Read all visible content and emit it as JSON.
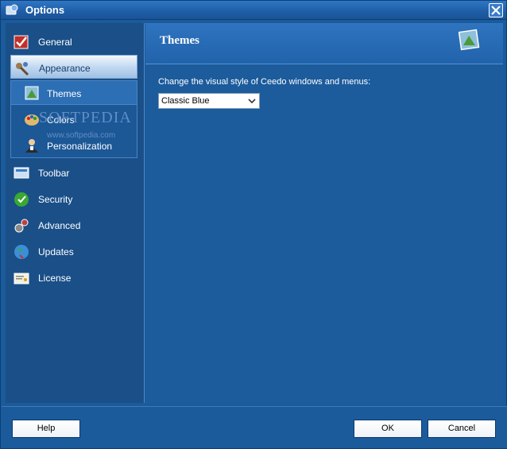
{
  "window": {
    "title": "Options",
    "title_icon": "ceedo-options-icon",
    "close_icon": "close-icon"
  },
  "sidebar": {
    "items": [
      {
        "label": "General",
        "icon": "general-check-icon"
      },
      {
        "label": "Appearance",
        "icon": "appearance-brush-icon",
        "selected": true
      },
      {
        "label": "Toolbar",
        "icon": "toolbar-icon"
      },
      {
        "label": "Security",
        "icon": "security-shield-icon"
      },
      {
        "label": "Advanced",
        "icon": "advanced-gears-icon"
      },
      {
        "label": "Updates",
        "icon": "updates-globe-icon"
      },
      {
        "label": "License",
        "icon": "license-certificate-icon"
      }
    ],
    "sub_items": [
      {
        "label": "Themes",
        "icon": "themes-icon"
      },
      {
        "label": "Colors",
        "icon": "colors-palette-icon"
      },
      {
        "label": "Personalization",
        "icon": "personalization-user-icon"
      }
    ],
    "watermark": "SOFTPEDIA",
    "watermark_url": "www.softpedia.com"
  },
  "content": {
    "title": "Themes",
    "prompt": "Change the visual style of Ceedo windows and menus:",
    "theme_select_value": "Classic Blue"
  },
  "footer": {
    "help_label": "Help",
    "ok_label": "OK",
    "cancel_label": "Cancel"
  },
  "colors": {
    "background": "#1b5b9b",
    "header": "#2f74c0",
    "selected_item": "#c2d9f1"
  }
}
